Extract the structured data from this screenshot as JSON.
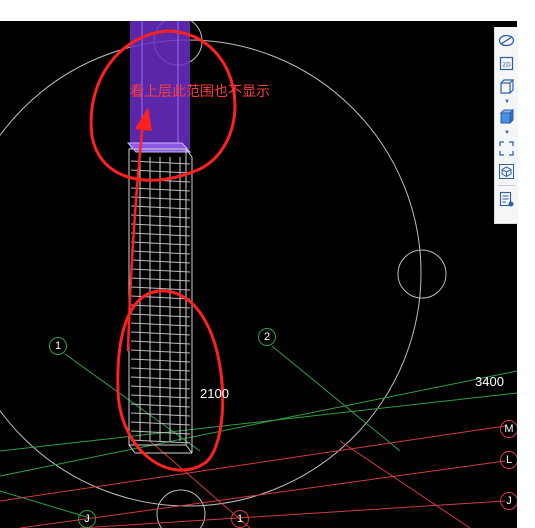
{
  "annotation": {
    "text": "看上层此范围也不显示",
    "color": "#ff3b3b"
  },
  "dimensions": {
    "d1": "2100",
    "d2": "3400"
  },
  "axes": {
    "grid_1_top": "1",
    "grid_2_top": "2",
    "grid_M": "M",
    "grid_L": "L",
    "grid_J_right": "J",
    "grid_J_bottom": "J",
    "grid_1_bottom": "1"
  },
  "toolbar": {
    "items": [
      {
        "icon": "rotate-view-icon"
      },
      {
        "icon": "2d-view-icon",
        "label": "2D"
      },
      {
        "icon": "wireframe-box-icon"
      },
      {
        "icon": "solid-box-icon"
      },
      {
        "icon": "fit-view-icon"
      },
      {
        "icon": "3d-cube-icon"
      },
      {
        "icon": "properties-list-icon"
      }
    ]
  },
  "colors": {
    "background": "#000000",
    "grid_green": "#2ea043",
    "grid_red": "#d43b3b",
    "column_purple": "#6a2ec7",
    "rebar": "#d0d0d0"
  }
}
